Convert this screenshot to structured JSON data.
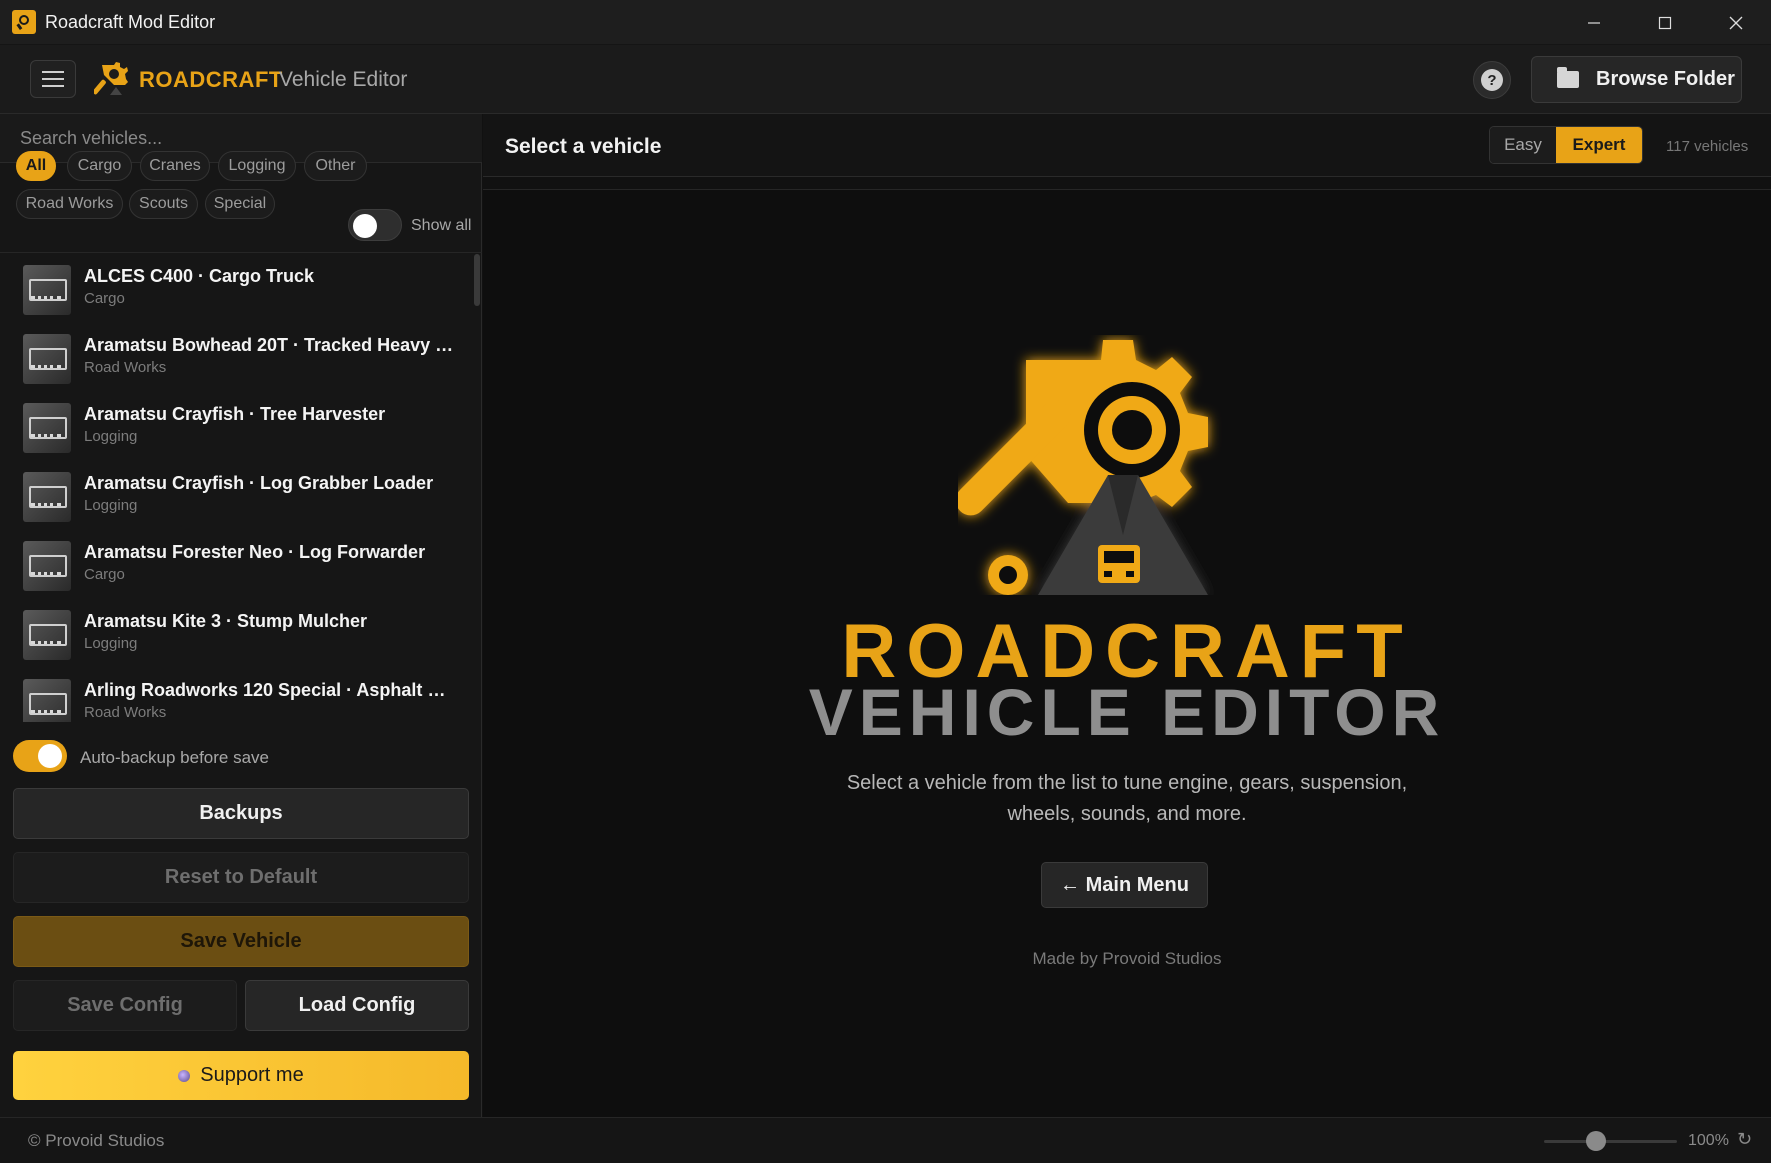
{
  "window": {
    "title": "Roadcraft Mod Editor"
  },
  "header": {
    "brand_name": "ROADCRAFT",
    "brand_sub": "Vehicle Editor",
    "help_label": "?",
    "browse_label": "Browse Folder"
  },
  "sidebar": {
    "search_placeholder": "Search vehicles...",
    "filters": [
      "All",
      "Cargo",
      "Cranes",
      "Logging",
      "Other",
      "Road Works",
      "Scouts",
      "Special"
    ],
    "active_filter": "All",
    "show_all_label": "Show all",
    "show_all_on": false,
    "vehicles": [
      {
        "name": "ALCES C400 · Cargo Truck",
        "category": "Cargo"
      },
      {
        "name": "Aramatsu Bowhead 20T · Tracked Heavy Du...",
        "category": "Road Works"
      },
      {
        "name": "Aramatsu Crayfish · Tree Harvester",
        "category": "Logging"
      },
      {
        "name": "Aramatsu Crayfish · Log Grabber Loader",
        "category": "Logging"
      },
      {
        "name": "Aramatsu Forester Neo · Log Forwarder",
        "category": "Cargo"
      },
      {
        "name": "Aramatsu Kite 3 · Stump Mulcher",
        "category": "Logging"
      },
      {
        "name": "Arling Roadworks 120 Special · Asphalt Paver",
        "category": "Road Works"
      }
    ],
    "auto_backup_label": "Auto-backup before save",
    "auto_backup_on": true,
    "buttons": {
      "backups": "Backups",
      "reset": "Reset to Default",
      "save_vehicle": "Save Vehicle",
      "save_config": "Save Config",
      "load_config": "Load Config",
      "support": "Support me"
    }
  },
  "main": {
    "title": "Select a vehicle",
    "modes": [
      "Easy",
      "Expert"
    ],
    "active_mode": "Expert",
    "vehicle_count": "117 vehicles",
    "hero_title_1": "ROADCRAFT",
    "hero_title_2": "VEHICLE EDITOR",
    "description": "Select a vehicle from the list to tune engine, gears, suspension, wheels, sounds, and more.",
    "main_menu_label": "← Main Menu",
    "made_by": "Made by Provoid Studios"
  },
  "statusbar": {
    "copyright": "© Provoid Studios",
    "zoom": "100%",
    "zoom_level": 0.35
  },
  "colors": {
    "accent": "#e8a317",
    "background": "#111111",
    "panel": "#161616"
  },
  "icons": {
    "app": "wrench-gear-icon",
    "menu": "hamburger-icon",
    "help": "question-icon",
    "folder": "folder-icon",
    "minimize": "minimize-icon",
    "maximize": "maximize-icon",
    "close": "close-icon",
    "reset_zoom": "refresh-icon"
  }
}
